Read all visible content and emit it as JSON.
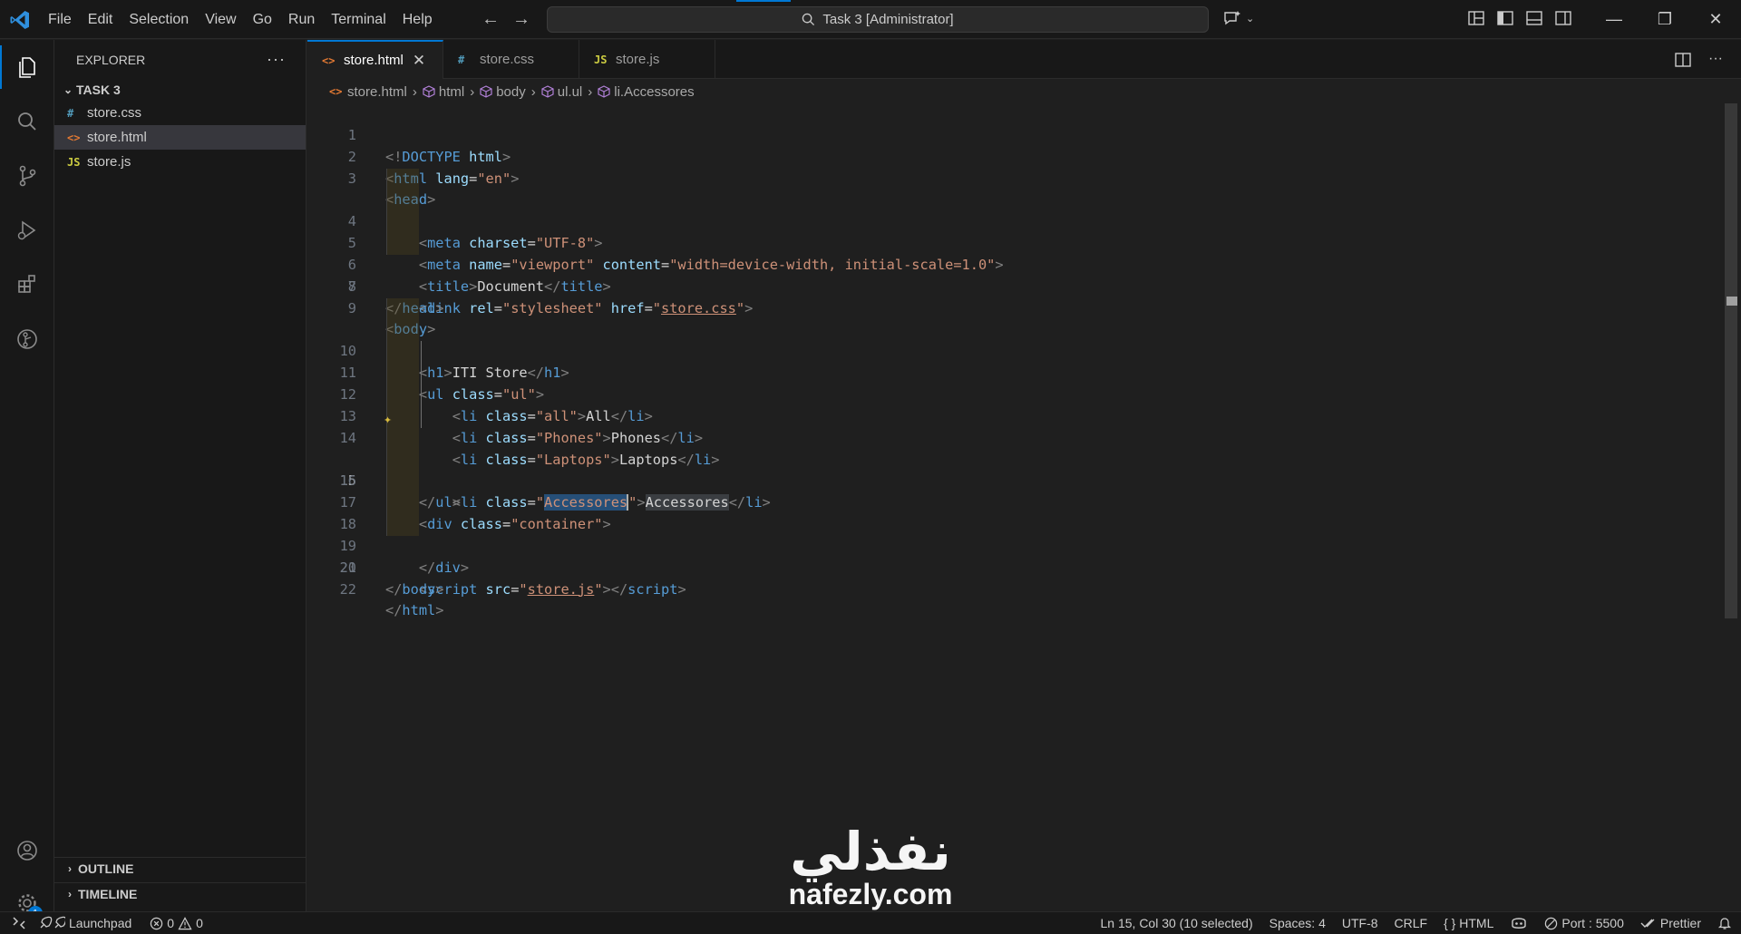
{
  "menu": [
    "File",
    "Edit",
    "Selection",
    "View",
    "Go",
    "Run",
    "Terminal",
    "Help"
  ],
  "command_center": "Task 3 [Administrator]",
  "sidebar": {
    "title": "EXPLORER",
    "folder": "TASK 3",
    "files": [
      {
        "name": "store.css",
        "type": "css",
        "icon": "#"
      },
      {
        "name": "store.html",
        "type": "html",
        "icon": "<>"
      },
      {
        "name": "store.js",
        "type": "js",
        "icon": "JS"
      }
    ],
    "outline": "OUTLINE",
    "timeline": "TIMELINE"
  },
  "accounts_badge": "1",
  "tabs": [
    {
      "name": "store.html",
      "type": "html",
      "icon": "<>",
      "active": true
    },
    {
      "name": "store.css",
      "type": "css",
      "icon": "#"
    },
    {
      "name": "store.js",
      "type": "js",
      "icon": "JS"
    }
  ],
  "breadcrumb": [
    "store.html",
    "html",
    "body",
    "ul.ul",
    "li.Accessores"
  ],
  "code_lines": [
    "1",
    "2",
    "3",
    "4",
    "5",
    "6",
    "7",
    "8",
    "9",
    "10",
    "11",
    "12",
    "13",
    "14",
    "15",
    "16",
    "17",
    "18",
    "19",
    "20",
    "21",
    "22"
  ],
  "current_line": "15",
  "code": {
    "doctype": "DOCTYPE",
    "html": "html",
    "lang_attr": "lang",
    "lang_val": "\"en\"",
    "head": "head",
    "meta": "meta",
    "charset_attr": "charset",
    "charset_val": "\"UTF-8\"",
    "name_attr": "name",
    "name_val": "\"viewport\"",
    "content_attr": "content",
    "content_val": "\"width=device-width, initial-scale=1.0\"",
    "title": "title",
    "title_text": "Document",
    "link": "link",
    "rel_attr": "rel",
    "rel_val": "\"stylesheet\"",
    "href_attr": "href",
    "href_val": "store.css",
    "body": "body",
    "h1": "h1",
    "h1_text": "ITI Store",
    "ul": "ul",
    "class_attr": "class",
    "ul_class": "\"ul\"",
    "li": "li",
    "li1_class": "\"all\"",
    "li1_text": "All",
    "li2_class": "\"Phones\"",
    "li2_text": "Phones",
    "li3_class": "\"Laptops\"",
    "li3_text": "Laptops",
    "li4_class": "Accessores",
    "li4_text": "Accessores",
    "div": "div",
    "div_class": "\"container\"",
    "script": "script",
    "src_attr": "src",
    "src_val": "store.js"
  },
  "watermark": {
    "arabic": "نفذلي",
    "url": "nafezly.com"
  },
  "status": {
    "launchpad": "Launchpad",
    "errors": "0",
    "warnings": "0",
    "position": "Ln 15, Col 30 (10 selected)",
    "spaces": "Spaces: 4",
    "encoding": "UTF-8",
    "eol": "CRLF",
    "language": "HTML",
    "port": "Port : 5500",
    "prettier": "Prettier"
  }
}
